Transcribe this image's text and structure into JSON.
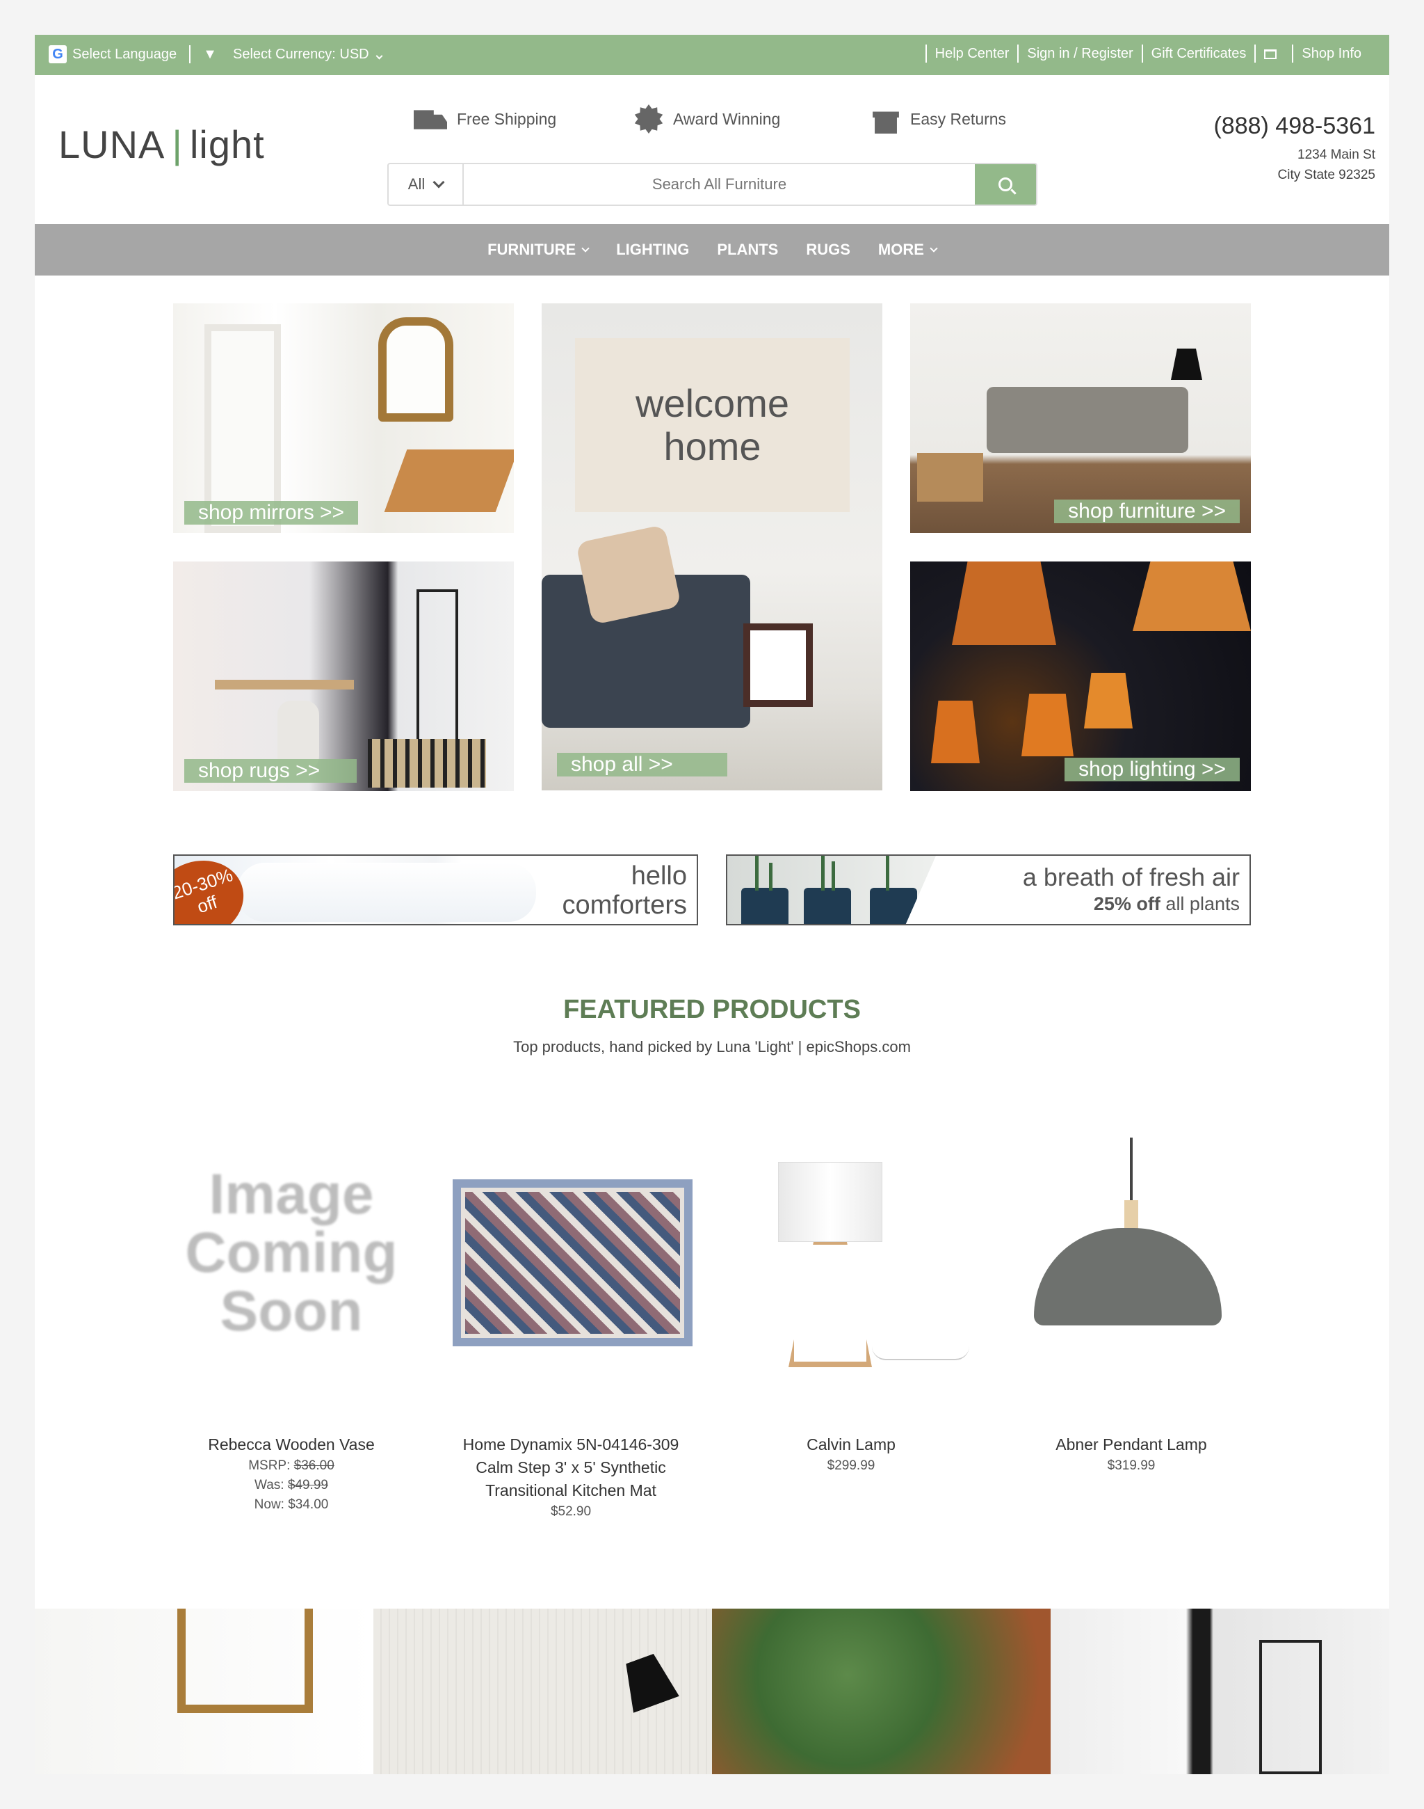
{
  "topbar": {
    "language": "Select Language",
    "language_arrow": "▼",
    "currency": "Select Currency: USD",
    "links": [
      "Help Center",
      "Sign in / Register",
      "Gift Certificates",
      "Shop Info"
    ]
  },
  "header": {
    "logo_luna": "LUNA",
    "logo_bar": "|",
    "logo_light": "light",
    "features": [
      {
        "icon": "truck-icon",
        "label": "Free Shipping"
      },
      {
        "icon": "award-icon",
        "label": "Award Winning"
      },
      {
        "icon": "gift-icon",
        "label": "Easy Returns"
      }
    ],
    "search": {
      "category": "All",
      "placeholder": "Search All Furniture"
    },
    "phone": "(888) 498-5361",
    "address_line1": "1234 Main St",
    "address_line2": "City State 92325"
  },
  "nav": {
    "items": [
      "FURNITURE",
      "LIGHTING",
      "PLANTS",
      "RUGS",
      "MORE"
    ]
  },
  "tiles": {
    "mirrors": "shop mirrors >>",
    "welcome_line1": "welcome",
    "welcome_line2": "home",
    "all": "shop all  >>",
    "furniture": "shop furniture >>",
    "rugs": "shop rugs >>",
    "lighting": "shop lighting >>"
  },
  "promos": {
    "comforters": {
      "badge_line1": "20-30%",
      "badge_line2": "off",
      "line1": "hello",
      "line2": "comforters"
    },
    "plants": {
      "line1": "a breath of fresh air",
      "line2_bold": "25% off",
      "line2_rest": "all plants"
    }
  },
  "featured": {
    "title": "FEATURED PRODUCTS",
    "subtitle": "Top products, hand picked by Luna 'Light' | epicShops.com",
    "placeholder_text": [
      "Image",
      "Coming",
      "Soon"
    ],
    "products": [
      {
        "name": "Rebecca Wooden Vase",
        "msrp_label": "MSRP:",
        "msrp": "$36.00",
        "was_label": "Was:",
        "was": "$49.99",
        "now": "Now: $34.00"
      },
      {
        "name": "Home Dynamix 5N-04146-309 Calm Step 3' x 5' Synthetic Transitional Kitchen Mat",
        "price": "$52.90"
      },
      {
        "name": "Calvin Lamp",
        "price": "$299.99"
      },
      {
        "name": "Abner Pendant Lamp",
        "price": "$319.99"
      }
    ]
  },
  "colors": {
    "accent": "#93b98a",
    "nav": "#a6a6a6",
    "heading": "#5e7d55",
    "badge": "#c04b14"
  }
}
